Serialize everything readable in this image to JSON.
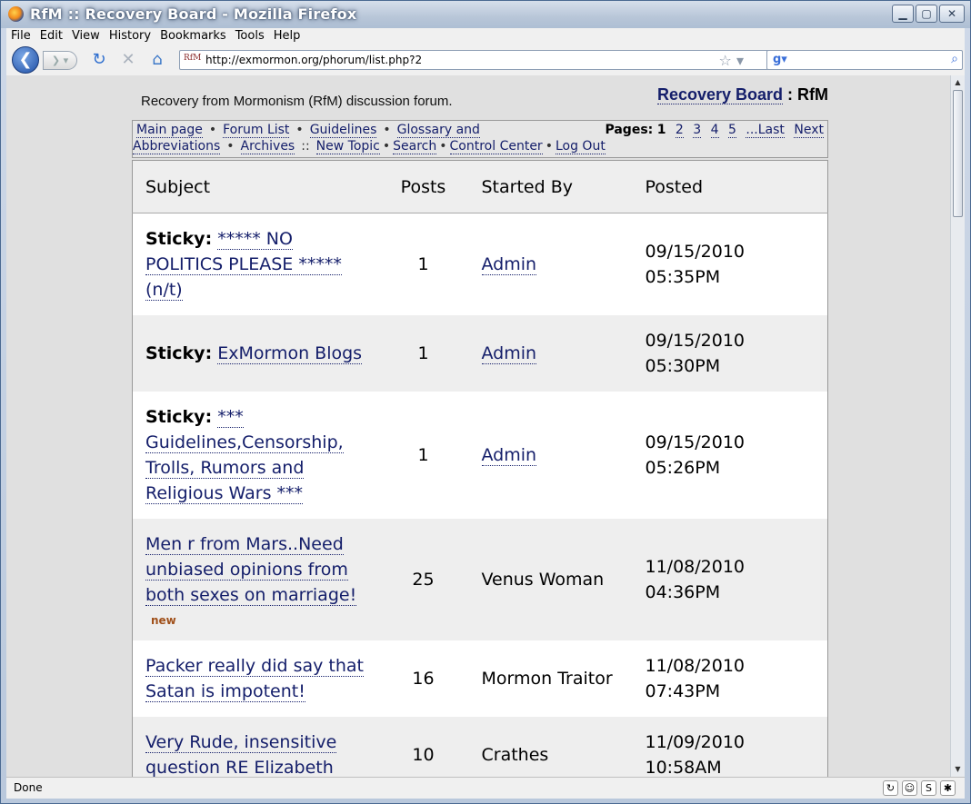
{
  "window": {
    "title": "RfM :: Recovery Board - Mozilla Firefox",
    "controls": {
      "minimize": "▁",
      "maximize": "▢",
      "close": "✕"
    }
  },
  "menubar": [
    "File",
    "Edit",
    "View",
    "History",
    "Bookmarks",
    "Tools",
    "Help"
  ],
  "toolbar": {
    "url": "http://exmormon.org/phorum/list.php?2",
    "favicon_text": "RfM",
    "back_icon": "back-arrow-icon",
    "forward_icon": "forward-arrow-icon",
    "reload_icon": "reload-icon",
    "stop_icon": "stop-icon",
    "home_icon": "home-icon",
    "search_placeholder": ""
  },
  "page": {
    "tagline": "Recovery from Mormonism (RfM) discussion forum.",
    "board_link": "Recovery Board",
    "board_suffix": " :  RfM",
    "nav": {
      "main_page": "Main page",
      "forum_list": "Forum List",
      "guidelines": "Guidelines",
      "glossary": "Glossary and",
      "abbreviations": "Abbreviations",
      "archives": "Archives",
      "new_topic": "New Topic",
      "search": "Search",
      "control_center": "Control Center",
      "log_out": "Log Out"
    },
    "pages": {
      "label": "Pages:",
      "current": "1",
      "others": [
        "2",
        "3",
        "4",
        "5"
      ],
      "last": "...Last",
      "next": "Next"
    }
  },
  "table": {
    "headers": {
      "subject": "Subject",
      "posts": "Posts",
      "started_by": "Started By",
      "posted": "Posted"
    },
    "rows": [
      {
        "sticky": "Sticky:",
        "subject": "***** NO POLITICS PLEASE ***** (n/t)",
        "posts": "1",
        "started_by": "Admin",
        "author_link": true,
        "posted": "09/15/2010 05:35PM",
        "new": ""
      },
      {
        "sticky": "Sticky:",
        "subject": "ExMormon Blogs",
        "posts": "1",
        "started_by": "Admin",
        "author_link": true,
        "posted": "09/15/2010 05:30PM",
        "new": ""
      },
      {
        "sticky": "Sticky:",
        "subject": "*** Guidelines,Censorship, Trolls, Rumors and Religious Wars ***",
        "posts": "1",
        "started_by": "Admin",
        "author_link": true,
        "posted": "09/15/2010 05:26PM",
        "new": ""
      },
      {
        "sticky": "",
        "subject": "Men r from Mars..Need unbiased opinions from both sexes on marriage!",
        "posts": "25",
        "started_by": "Venus Woman",
        "author_link": false,
        "posted": "11/08/2010 04:36PM",
        "new": "new"
      },
      {
        "sticky": "",
        "subject": "Packer really did say that Satan is impotent!",
        "posts": "16",
        "started_by": "Mormon Traitor",
        "author_link": false,
        "posted": "11/08/2010 07:43PM",
        "new": ""
      },
      {
        "sticky": "",
        "subject": "Very Rude, insensitive question RE Elizabeth",
        "posts": "10",
        "started_by": "Crathes",
        "author_link": false,
        "posted": "11/09/2010 10:58AM",
        "new": ""
      }
    ]
  },
  "statusbar": {
    "text": "Done"
  }
}
